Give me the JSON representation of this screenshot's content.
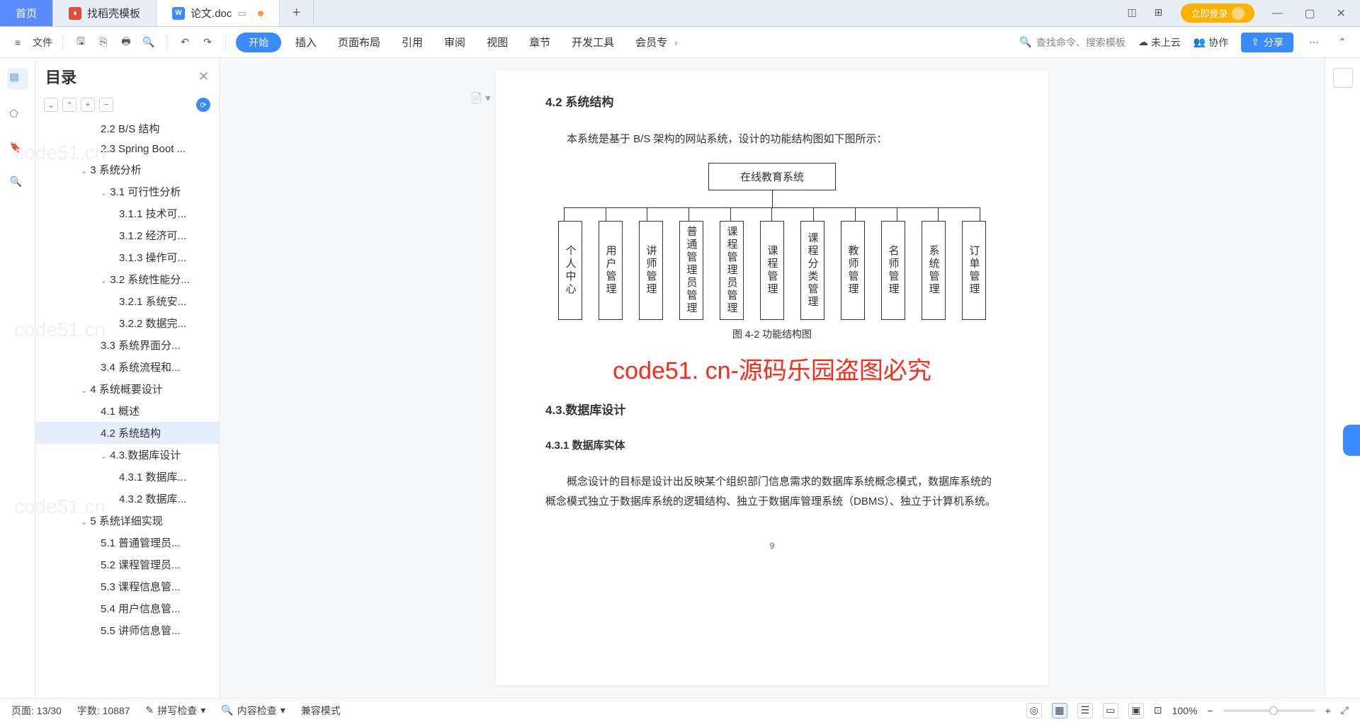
{
  "tabs": {
    "home": "首页",
    "t1": "找稻壳模板",
    "t2": "论文.doc",
    "plus": "+"
  },
  "topright": {
    "login": "立即登录"
  },
  "ribbon": {
    "file": "文件",
    "start_pill": "开始",
    "menus": [
      "插入",
      "页面布局",
      "引用",
      "审阅",
      "视图",
      "章节",
      "开发工具",
      "会员专"
    ],
    "search_ph": "查找命令、搜索模板",
    "cloud": "未上云",
    "collab": "协作",
    "share": "分享"
  },
  "outline": {
    "title": "目录",
    "items": [
      {
        "t": "2.2 B/S 结构",
        "lvl": "ind0"
      },
      {
        "t": "2.3 Spring Boot ...",
        "lvl": "ind0"
      },
      {
        "t": "3 系统分析",
        "lvl": "ind1",
        "ch": "⌄"
      },
      {
        "t": "3.1 可行性分析",
        "lvl": "ind2",
        "ch": "⌄"
      },
      {
        "t": "3.1.1 技术可...",
        "lvl": "ind3"
      },
      {
        "t": "3.1.2 经济可...",
        "lvl": "ind3"
      },
      {
        "t": "3.1.3 操作可...",
        "lvl": "ind3"
      },
      {
        "t": "3.2 系统性能分...",
        "lvl": "ind2",
        "ch": "⌄"
      },
      {
        "t": "3.2.1  系统安...",
        "lvl": "ind3"
      },
      {
        "t": "3.2.2  数据完...",
        "lvl": "ind3"
      },
      {
        "t": "3.3 系统界面分...",
        "lvl": "ind2"
      },
      {
        "t": "3.4 系统流程和...",
        "lvl": "ind2"
      },
      {
        "t": "4 系统概要设计",
        "lvl": "ind1",
        "ch": "⌄"
      },
      {
        "t": "4.1 概述",
        "lvl": "ind2"
      },
      {
        "t": "4.2 系统结构",
        "lvl": "ind2",
        "sel": true
      },
      {
        "t": "4.3.数据库设计",
        "lvl": "ind2",
        "ch": "⌄"
      },
      {
        "t": "4.3.1 数据库...",
        "lvl": "ind3"
      },
      {
        "t": "4.3.2 数据库...",
        "lvl": "ind3"
      },
      {
        "t": "5 系统详细实现",
        "lvl": "ind1",
        "ch": "⌄"
      },
      {
        "t": "5.1  普通管理员...",
        "lvl": "ind2"
      },
      {
        "t": "5.2  课程管理员...",
        "lvl": "ind2"
      },
      {
        "t": "5.3  课程信息管...",
        "lvl": "ind2"
      },
      {
        "t": "5.4  用户信息管...",
        "lvl": "ind2"
      },
      {
        "t": "5.5  讲师信息管...",
        "lvl": "ind2"
      }
    ]
  },
  "doc": {
    "h42": "4.2 系统结构",
    "p1": "本系统是基于 B/S 架构的网站系统，设计的功能结构图如下图所示：",
    "root": "在线教育系统",
    "nodes": [
      "个人中心",
      "用户管理",
      "讲师管理",
      "普通管理员管理",
      "课程管理员管理",
      "课程管理",
      "课程分类管理",
      "教师管理",
      "名师管理",
      "系统管理",
      "订单管理"
    ],
    "figcap": "图 4-2 功能结构图",
    "wm": "code51. cn-源码乐园盗图必究",
    "h43": "4.3.数据库设计",
    "h431": "4.3.1 数据库实体",
    "p2": "概念设计的目标是设计出反映某个组织部门信息需求的数据库系统概念模式，数据库系统的概念模式独立于数据库系统的逻辑结构、独立于数据库管理系统（DBMS）、独立于计算机系统。",
    "pgno": "9"
  },
  "status": {
    "page": "页面: 13/30",
    "words": "字数: 10887",
    "spell": "拼写检查",
    "content": "内容检查",
    "compat": "兼容模式",
    "zoom": "100%"
  },
  "bgwm": "code51.cn"
}
